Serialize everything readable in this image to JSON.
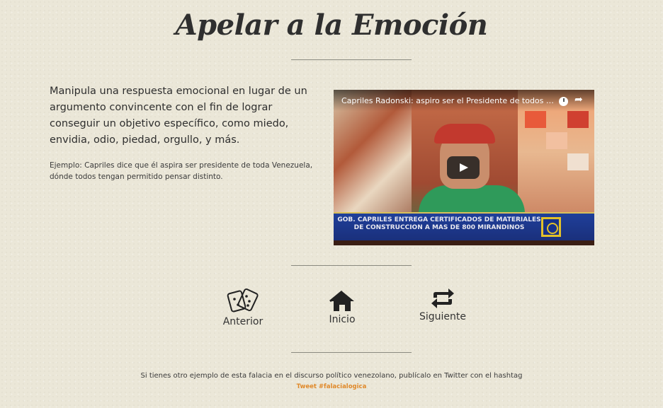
{
  "page": {
    "title": "Apelar a la Emoción",
    "description": "Manipula una respuesta emocional en lugar de un argumento convincente con el fin de lograr conseguir un objetivo específico, como miedo, envidia, odio, piedad, orgullo, y más.",
    "example": "Ejemplo: Capriles dice que él aspira ser presidente de toda Venezuela, dónde todos tengan permitido pensar distinto."
  },
  "video": {
    "title": "Capriles Radonski: aspiro ser el Presidente de todos los ...",
    "banner_text": "GOB. CAPRILES ENTREGA CERTIFICADOS DE MATERIALES DE CONSTRUCCION A MAS DE 800 MIRANDINOS"
  },
  "nav": {
    "prev_label": "Anterior",
    "home_label": "Inicio",
    "next_label": "Siguiente",
    "prev_icon": "dice-icon",
    "home_icon": "home-icon",
    "next_icon": "repeat-icon"
  },
  "footer": {
    "text": "Si tienes otro ejemplo de esta falacia en el discurso político venezolano, publícalo en Twitter con el hashtag",
    "tweet_link": "Tweet #falacialogica"
  },
  "colors": {
    "background": "#ebe7d8",
    "accent": "#e0892a",
    "text": "#2e2e2e"
  }
}
